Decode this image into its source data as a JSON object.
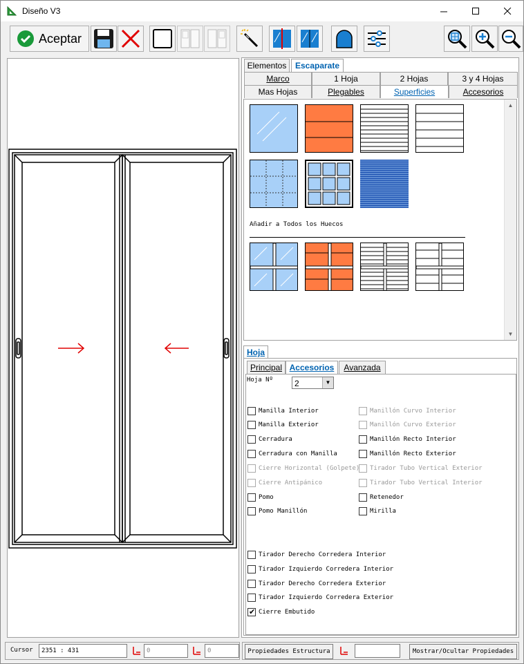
{
  "window": {
    "title": "Diseño V3"
  },
  "toolbar": {
    "accept_label": "Aceptar"
  },
  "top_tabs": [
    {
      "label": "Elementos"
    },
    {
      "label": "Escaparate"
    }
  ],
  "sub_tabs_row1": [
    {
      "label": "Marco"
    },
    {
      "label": "1 Hoja"
    },
    {
      "label": "2 Hojas"
    },
    {
      "label": "3 y 4 Hojas"
    }
  ],
  "sub_tabs_row2": [
    {
      "label": "Mas Hojas"
    },
    {
      "label": "Plegables"
    },
    {
      "label": "Superficies"
    },
    {
      "label": "Accesorios"
    }
  ],
  "surfaces": {
    "add_all_label": "Añadir a Todos los Huecos"
  },
  "hoja": {
    "tab_label": "Hoja",
    "tabs": [
      {
        "label": "Principal"
      },
      {
        "label": "Accesorios"
      },
      {
        "label": "Avanzada"
      }
    ],
    "number_label": "Hoja Nº",
    "number_value": "2",
    "left_checks": [
      {
        "label": "Manilla Interior"
      },
      {
        "label": "Manilla Exterior"
      },
      {
        "label": "Cerradura"
      },
      {
        "label": "Cerradura con Manilla"
      },
      {
        "label": "Cierre Horizontal (Golpete)"
      },
      {
        "label": "Cierre Antipánico"
      },
      {
        "label": "Pomo"
      },
      {
        "label": "Pomo Manillón"
      }
    ],
    "right_checks": [
      {
        "label": "Manillón Curvo Interior"
      },
      {
        "label": "Manillón Curvo Exterior"
      },
      {
        "label": "Manillón Recto Interior"
      },
      {
        "label": "Manillón Recto Exterior"
      },
      {
        "label": "Tirador Tubo Vertical Exterior"
      },
      {
        "label": "Tirador Tubo Vertical Interior"
      },
      {
        "label": "Retenedor"
      },
      {
        "label": "Mirilla"
      }
    ],
    "bottom_checks": [
      {
        "label": "Tirador Derecho Corredera Interior"
      },
      {
        "label": "Tirador Izquierdo Corredera Interior"
      },
      {
        "label": "Tirador Derecho Corredera Exterior"
      },
      {
        "label": "Tirador Izquierdo Corredera Exterior"
      },
      {
        "label": "Cierre Embutido"
      }
    ]
  },
  "status": {
    "cursor_label": "Cursor",
    "cursor_value": "2351 : 431",
    "field1_value": "0",
    "field2_value": "0",
    "props_button": "Propiedades Estructura",
    "field3_value": "",
    "toggle_button": "Mostrar/Ocultar Propiedades"
  },
  "colors": {
    "accent": "#0063b1",
    "orange": "#ff7b42",
    "glass": "#a8d0f8",
    "arrow": "#e00000"
  }
}
